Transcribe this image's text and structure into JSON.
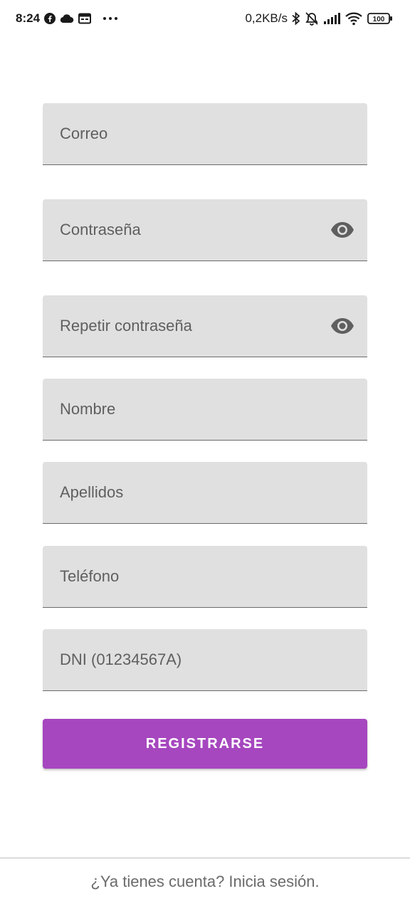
{
  "status_bar": {
    "time": "8:24",
    "left_icons": [
      "facebook-icon",
      "cloud-icon",
      "calendar-icon",
      "more-icon"
    ],
    "network_speed": "0,2KB/s",
    "right_icons": [
      "bluetooth-icon",
      "mute-icon",
      "signal-icon",
      "wifi-icon"
    ],
    "battery": "100"
  },
  "form": {
    "email_placeholder": "Correo",
    "password_placeholder": "Contraseña",
    "repeat_password_placeholder": "Repetir contraseña",
    "name_placeholder": "Nombre",
    "surname_placeholder": "Apellidos",
    "phone_placeholder": "Teléfono",
    "dni_placeholder": "DNI (01234567A)",
    "register_label": "REGISTRARSE"
  },
  "footer": {
    "login_prompt": "¿Ya tienes cuenta? Inicia sesión."
  },
  "colors": {
    "accent": "#a647bf",
    "field_background": "#e0e0e0"
  }
}
